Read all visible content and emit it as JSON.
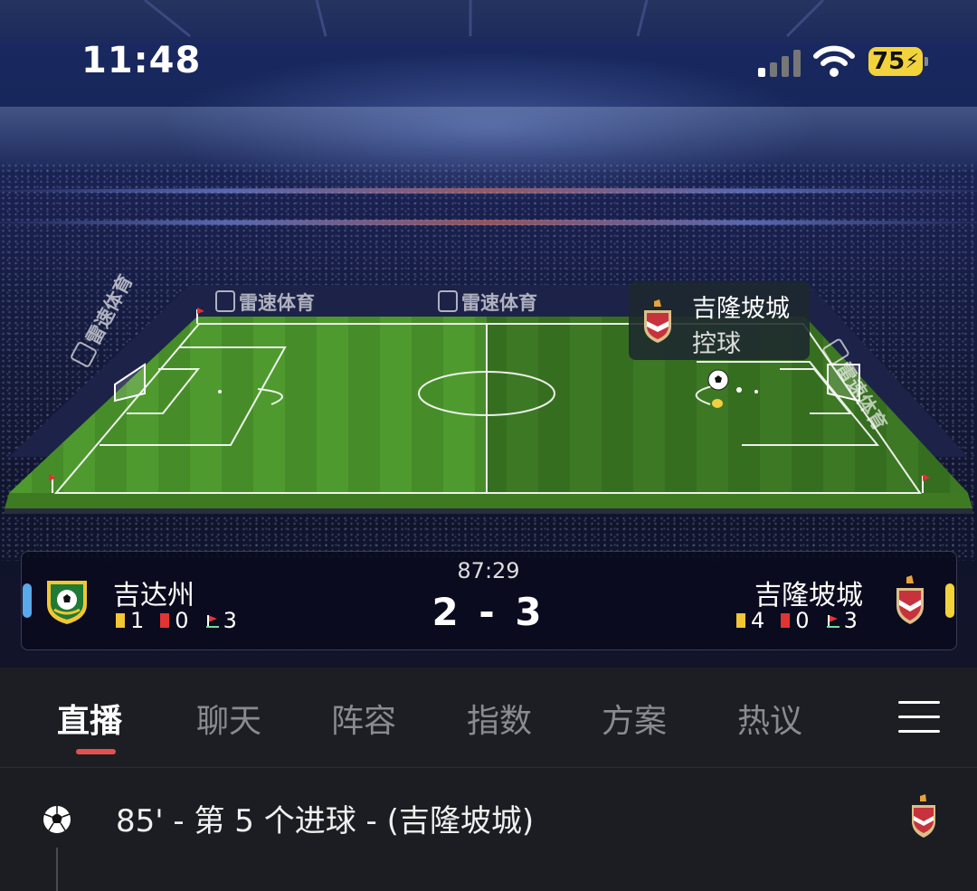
{
  "status_bar": {
    "time": "11:48",
    "battery": "75"
  },
  "watermark": "雷速体育",
  "possession": {
    "team": "吉隆坡城",
    "state": "控球"
  },
  "match": {
    "time": "87:29",
    "score": "2 - 3",
    "home": {
      "name": "吉达州",
      "yellow": "1",
      "red": "0",
      "corners": "3",
      "color": "#5aa9ea"
    },
    "away": {
      "name": "吉隆坡城",
      "yellow": "4",
      "red": "0",
      "corners": "3",
      "color": "#f2d33b"
    }
  },
  "tabs": [
    "直播",
    "聊天",
    "阵容",
    "指数",
    "方案",
    "热议"
  ],
  "active_tab": "直播",
  "events": [
    {
      "text": "85' - 第 5 个进球 - (吉隆坡城)",
      "icon": "soccer-ball-icon"
    }
  ]
}
